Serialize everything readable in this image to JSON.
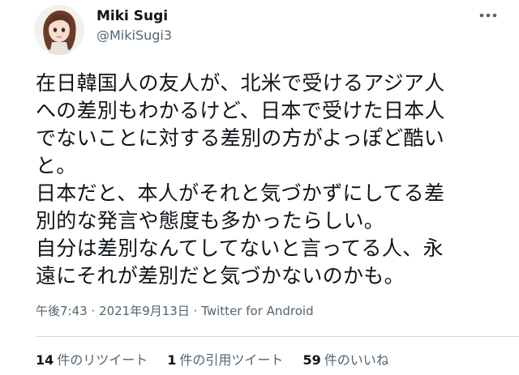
{
  "author": {
    "display_name": "Miki Sugi",
    "handle": "@MikiSugi3",
    "avatar_icon": "profile-photo"
  },
  "more_icon": "more-horizontal-icon",
  "tweet": {
    "lines": [
      "在日韓国人の友人が、北米で受けるアジア人",
      "への差別もわかるけど、日本で受けた日本人",
      "でないことに対する差別の方がよっぽど酷い",
      "と。",
      "日本だと、本人がそれと気づかずにしてる差",
      "別的な発言や態度も多かったらしい。",
      "自分は差別なんてしてないと言ってる人、永",
      "遠にそれが差別だと気づかないのかも。"
    ]
  },
  "meta": {
    "time": "午後7:43",
    "date": "2021年9月13日",
    "separator": "·",
    "source": "Twitter for Android"
  },
  "stats": {
    "retweets": {
      "count": "14",
      "label": "件のリツイート"
    },
    "quotes": {
      "count": "1",
      "label": "件の引用ツイート"
    },
    "likes": {
      "count": "59",
      "label": "件のいいね"
    }
  },
  "colors": {
    "text": "#0f1419",
    "secondary": "#536471",
    "divider": "#cfd9de"
  }
}
